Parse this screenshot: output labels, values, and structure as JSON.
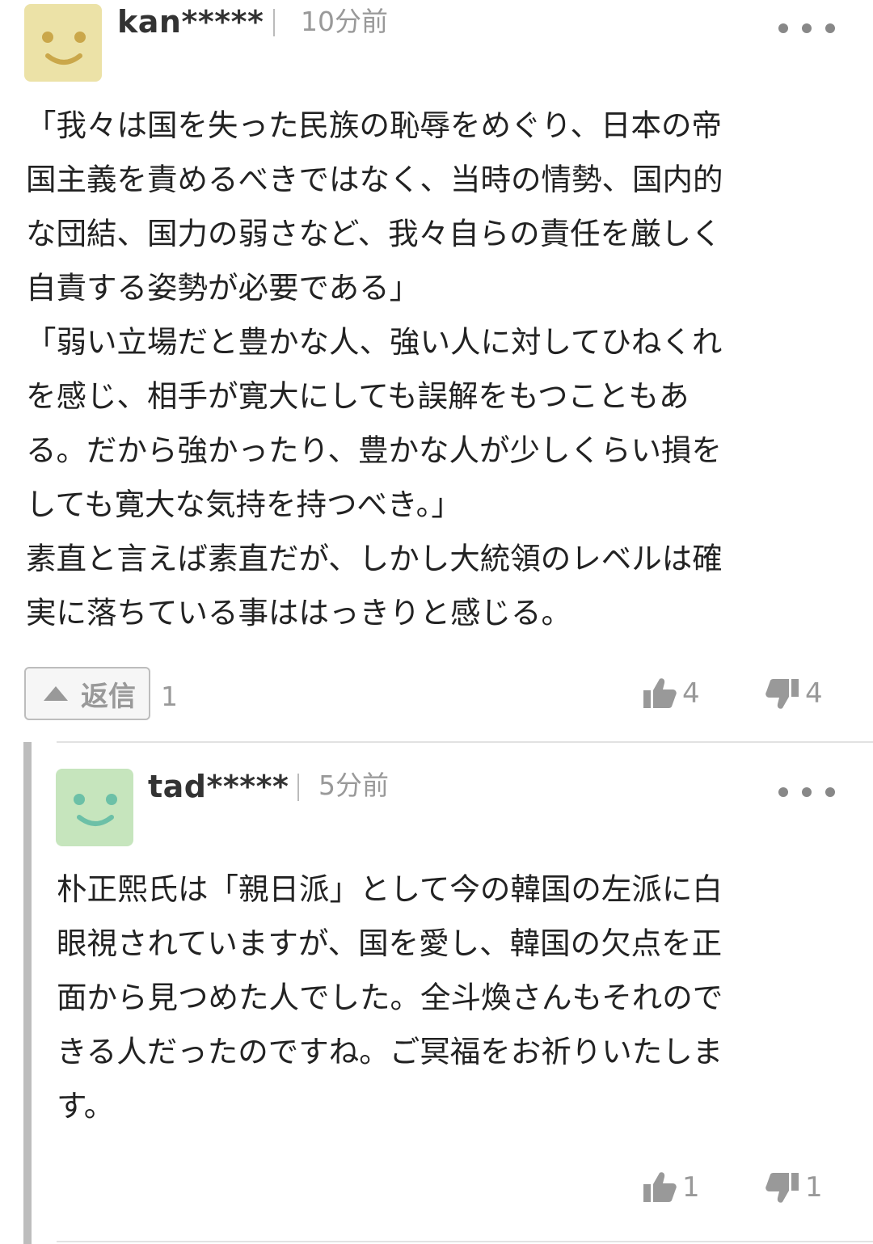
{
  "comments": [
    {
      "user": "kan*****",
      "time": "10分前",
      "avatar_color": "#ece2a7",
      "avatar_face_color": "#caa74a",
      "body": "「我々は国を失った民族の恥辱をめぐり、日本の帝\n国主義を責めるべきではなく、当時の情勢、国内的\nな団結、国力の弱さなど、我々自らの責任を厳しく\n自責する姿勢が必要である」\n「弱い立場だと豊かな人、強い人に対してひねくれ\nを感じ、相手が寛大にしても誤解をもつこともあ\nる。だから強かったり、豊かな人が少しくらい損を\nしても寛大な気持を持つべき。」\n素直と言えば素直だが、しかし大統領のレベルは確\n実に落ちている事ははっきりと感じる。",
      "reply_label": "返信",
      "reply_count": "1",
      "likes": "4",
      "dislikes": "4"
    },
    {
      "user": "tad*****",
      "time": "5分前",
      "avatar_color": "#c6e5bd",
      "avatar_face_color": "#6cc0a7",
      "body": "朴正熙氏は「親日派」として今の韓国の左派に白\n眼視されていますが、国を愛し、韓国の欠点を正\n面から見つめた人でした。全斗煥さんもそれので\nきる人だったのですね。ご冥福をお祈りいたしま\nす。",
      "likes": "1",
      "dislikes": "1"
    }
  ],
  "icons": {
    "more": "more-horizontal-icon",
    "reply": "triangle-up-icon",
    "like": "thumbs-up-icon",
    "dislike": "thumbs-down-icon"
  },
  "colors": {
    "meta_text": "#999999",
    "body_text": "#222222",
    "thread_bar": "#bdbdbd"
  }
}
